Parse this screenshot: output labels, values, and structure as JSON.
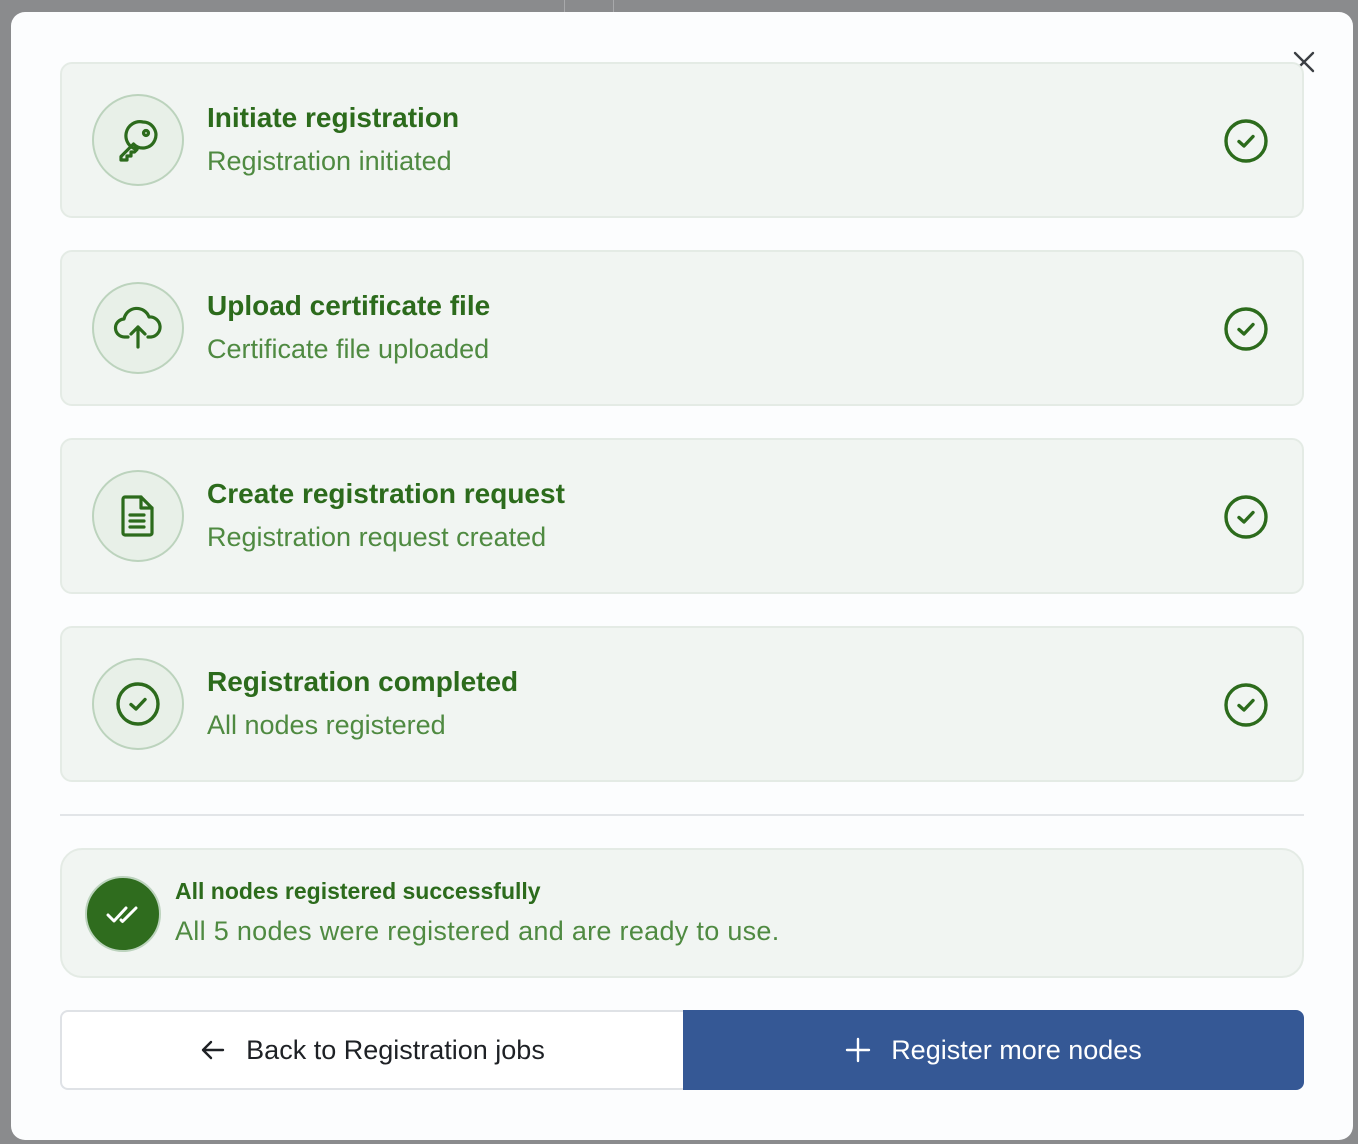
{
  "colors": {
    "success_green": "#2c6b1c",
    "success_green_light": "#4f8a41",
    "card_bg": "#f1f5f2",
    "primary_blue": "#355895"
  },
  "dialog": {
    "close_icon": "close-icon"
  },
  "steps": [
    {
      "title": "Initiate registration",
      "subtitle": "Registration initiated",
      "icon": "key-icon",
      "status": "completed"
    },
    {
      "title": "Upload certificate file",
      "subtitle": "Certificate file uploaded",
      "icon": "cloud-upload-icon",
      "status": "completed"
    },
    {
      "title": "Create registration request",
      "subtitle": "Registration request created",
      "icon": "document-icon",
      "status": "completed"
    },
    {
      "title": "Registration completed",
      "subtitle": "All nodes registered",
      "icon": "check-circle-icon",
      "status": "completed"
    }
  ],
  "success": {
    "title": "All nodes registered successfully",
    "message": "All 5 nodes were registered and are ready to use.",
    "icon": "double-check-icon"
  },
  "actions": {
    "back_label": "Back to Registration jobs",
    "back_icon": "arrow-left-icon",
    "primary_label": "Register more nodes",
    "primary_icon": "plus-icon"
  }
}
